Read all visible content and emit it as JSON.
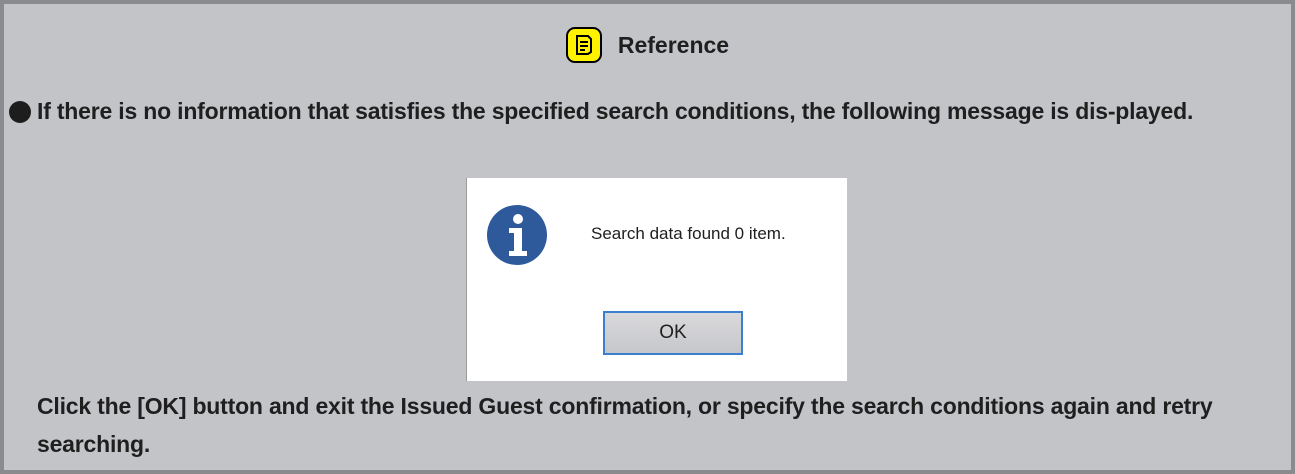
{
  "reference": {
    "title": "Reference",
    "icon": "note-icon",
    "accent_color": "#fff200",
    "background_color": "#c3c4c8"
  },
  "bullet": {
    "text": "If there is no information that satisfies the specified search conditions, the following message is dis-played."
  },
  "dialog": {
    "icon": "info-icon",
    "message": "Search data found 0 item.",
    "ok_label": "OK",
    "icon_color": "#2e5a9b"
  },
  "footer": {
    "text": "Click the [OK] button and exit the Issued Guest confirmation, or specify the search conditions again and retry searching."
  }
}
